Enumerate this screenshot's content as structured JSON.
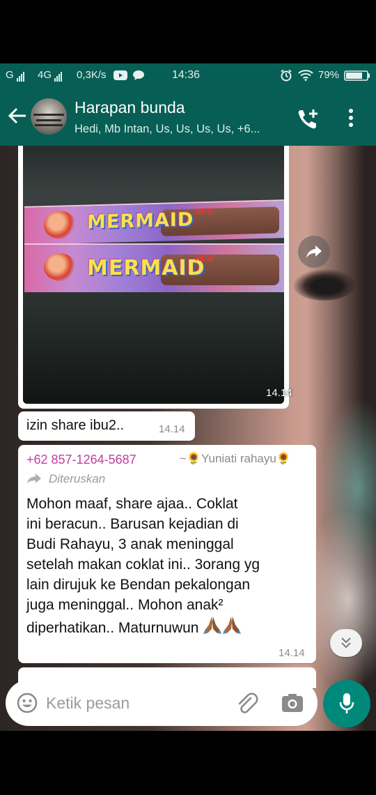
{
  "status_bar": {
    "carrier": "G",
    "network": "4G",
    "speed": "0,3K/s",
    "time": "14:36",
    "battery": "79%"
  },
  "header": {
    "title": "Harapan bunda",
    "members": "Hedi, Mb Intan, Us, Us, Us, Us, +6..."
  },
  "image_message": {
    "time": "14.14",
    "brand_text": "MERMAID",
    "burst_text": "NEW"
  },
  "share_message": {
    "text": "izin share ibu2..",
    "time": "14.14"
  },
  "forwarded_message": {
    "sender_number": "+62 857-1264-5687",
    "sender_name": "~🌻Yuniati rahayu🌻",
    "forwarded_label": "Diteruskan",
    "body": "Mohon maaf, share ajaa.. Coklat\nini beracun.. Barusan kejadian di\nBudi Rahayu,  3 anak meninggal\nsetelah makan coklat ini.. 3orang yg\nlain dirujuk ke Bendan pekalongan\njuga meninggal.. Mohon anak²\ndiperhatikan.. Maturnuwun",
    "time": "14.14"
  },
  "input": {
    "placeholder": "Ketik pesan"
  },
  "colors": {
    "header": "#075e54",
    "accent": "#00897b",
    "sender": "#c13ea0"
  }
}
